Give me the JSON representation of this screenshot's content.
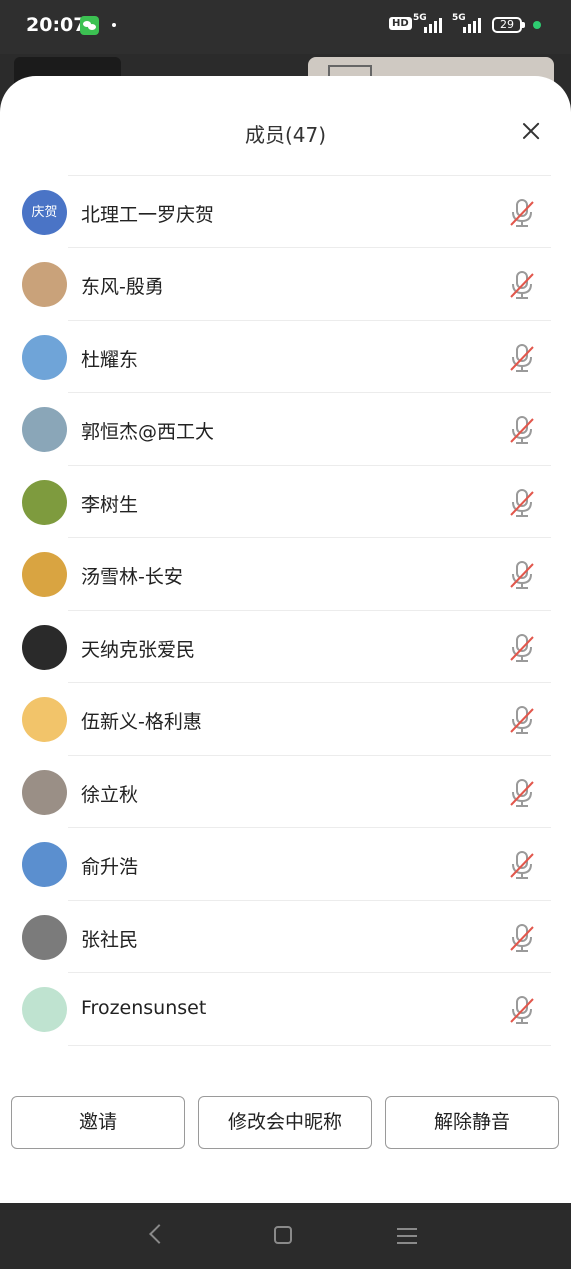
{
  "status_bar": {
    "time": "20:07",
    "hd_label": "HD",
    "net1": "5G",
    "net2": "5G",
    "battery": "29",
    "icons": [
      "wechat-icon",
      "dot-icon",
      "hd-icon",
      "signal-icon",
      "signal-icon",
      "battery-icon",
      "green-dot-icon"
    ]
  },
  "sheet": {
    "title": "成员(47)",
    "close_icon": "close-icon"
  },
  "members": [
    {
      "name": "",
      "avatar_text": "",
      "avatar_color": "#4a74c6",
      "muted": true
    },
    {
      "name": "北理工一罗庆贺",
      "avatar_text": "庆贺",
      "avatar_color": "#4a74c6",
      "muted": true
    },
    {
      "name": "东风-殷勇",
      "avatar_text": "",
      "avatar_color": "#c9a27a",
      "muted": true
    },
    {
      "name": "杜耀东",
      "avatar_text": "",
      "avatar_color": "#6fa4d8",
      "muted": true
    },
    {
      "name": "郭恒杰@西工大",
      "avatar_text": "",
      "avatar_color": "#8aa6b8",
      "muted": true
    },
    {
      "name": "李树生",
      "avatar_text": "",
      "avatar_color": "#7e9b3e",
      "muted": true
    },
    {
      "name": "汤雪林-长安",
      "avatar_text": "",
      "avatar_color": "#d9a441",
      "muted": true
    },
    {
      "name": "天纳克张爱民",
      "avatar_text": "",
      "avatar_color": "#2a2a2a",
      "muted": true
    },
    {
      "name": "伍新义-格利惠",
      "avatar_text": "",
      "avatar_color": "#f2c46a",
      "muted": true
    },
    {
      "name": "徐立秋",
      "avatar_text": "",
      "avatar_color": "#9a8f86",
      "muted": true
    },
    {
      "name": "俞升浩",
      "avatar_text": "",
      "avatar_color": "#5b8fcf",
      "muted": true
    },
    {
      "name": "张社民",
      "avatar_text": "",
      "avatar_color": "#7b7b7b",
      "muted": true
    },
    {
      "name": "Frozensunset",
      "avatar_text": "",
      "avatar_color": "#bfe3d0",
      "muted": true
    }
  ],
  "actions": {
    "invite": "邀请",
    "rename": "修改会中昵称",
    "unmute": "解除静音"
  },
  "nav": {
    "icons": [
      "back-icon",
      "home-icon",
      "menu-icon"
    ]
  },
  "colors": {
    "mute_red": "#e2574c",
    "mic_gray": "#9a9a9a",
    "divider": "#ececec"
  }
}
